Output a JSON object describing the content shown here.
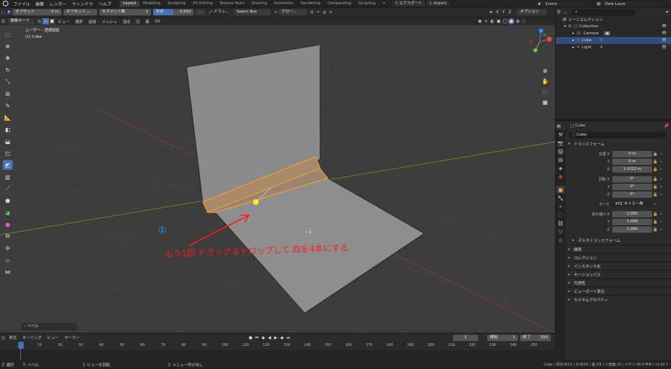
{
  "top_menu": {
    "items": [
      "ファイル",
      "編集",
      "レンダー",
      "ウィンドウ",
      "ヘルプ"
    ],
    "workspaces": [
      "Layout",
      "Modeling",
      "Sculpting",
      "UV Editing",
      "Texture Paint",
      "Shading",
      "Animation",
      "Rendering",
      "Compositing",
      "Scripting"
    ],
    "active_workspace": "Layout",
    "plus": "+",
    "export_label": "エクスポート",
    "import_label": "Import",
    "scene": "Scene",
    "view_layer": "View Layer"
  },
  "tool_header": {
    "offset_label": "オフセット",
    "offset_value": "0 m",
    "offset_type": "オフセット",
    "segments_label": "セグメント数",
    "segments_value": "1",
    "shape_label": "形状",
    "shape_value": "0.500",
    "drag_label": "ドラッ...",
    "select_box": "Select Box",
    "transform_orientation": "グロー...",
    "axes": [
      "X",
      "Y",
      "Z"
    ],
    "options": "オプション"
  },
  "viewport_header": {
    "mode": "編集モード",
    "menus": [
      "ビュー",
      "選択",
      "追加",
      "メッシュ",
      "頂点",
      "辺",
      "面",
      "UV"
    ]
  },
  "viewport": {
    "view_name": "ユーザー・透視投影",
    "object_name": "(1) Cube",
    "annotation_circle": "①",
    "annotation_text": "もう1回 ドラッグ＆ドロップして 四を4本にする",
    "last_operator": "ベベル",
    "colors": {
      "background": "#3d3d3d",
      "mesh_face": "#8b8b8b",
      "selected_face": "#b08a5c",
      "selected_edge": "#ffa032",
      "annotation": "#ff1a1a",
      "annotation_blue": "#1ea0ff",
      "x_axis": "#8a3a3a",
      "y_axis": "#6b8a2a",
      "accent": "#4772b3"
    }
  },
  "timeline": {
    "menus": [
      "再生",
      "キーイング",
      "ビュー",
      "マーカー"
    ],
    "current_frame": "1",
    "start_label": "開始",
    "start_value": "1",
    "end_label": "終了",
    "end_value": "250",
    "ticks": [
      "1",
      "10",
      "20",
      "30",
      "40",
      "50",
      "60",
      "70",
      "80",
      "90",
      "100",
      "110",
      "120",
      "130",
      "140",
      "150",
      "160",
      "170",
      "180",
      "190",
      "200",
      "210",
      "220",
      "230",
      "240",
      "250"
    ]
  },
  "status_bar": {
    "left": [
      "選択",
      "ベベル",
      "ビューを回転",
      "メニュー呼び出し"
    ],
    "right": "Cube | 頂点:8/12 | 辺:8/16 | 面:2/5 | 三角面:10 | メモリ:45.0 MiB | v2.82.7"
  },
  "outliner": {
    "root": "シーンコレクション",
    "collection": "Collection",
    "items": [
      {
        "name": "Camera",
        "selected": false
      },
      {
        "name": "Cube",
        "selected": true
      },
      {
        "name": "Light",
        "selected": false
      }
    ]
  },
  "properties": {
    "object_name": "Cube",
    "object_field": "Cube",
    "transform_section": "トランスフォーム",
    "location_label": "位置 X",
    "location": [
      "0 m",
      "0 m",
      "1.1022 m"
    ],
    "rotation_label": "回転 X",
    "rotation": [
      "0°",
      "0°",
      "0°"
    ],
    "mode_label": "モード",
    "mode_value": "XYZ オイラー角",
    "scale_label": "拡大縮小 X",
    "scale": [
      "1.000",
      "1.000",
      "1.000"
    ],
    "axis_y": "Y",
    "axis_z": "Z",
    "delta": "デルタトランスフォーム",
    "sections": [
      "関係",
      "コレクション",
      "インスタンス化",
      "モーションパス",
      "可視性",
      "ビューポート表示",
      "カスタムプロパティ"
    ]
  }
}
